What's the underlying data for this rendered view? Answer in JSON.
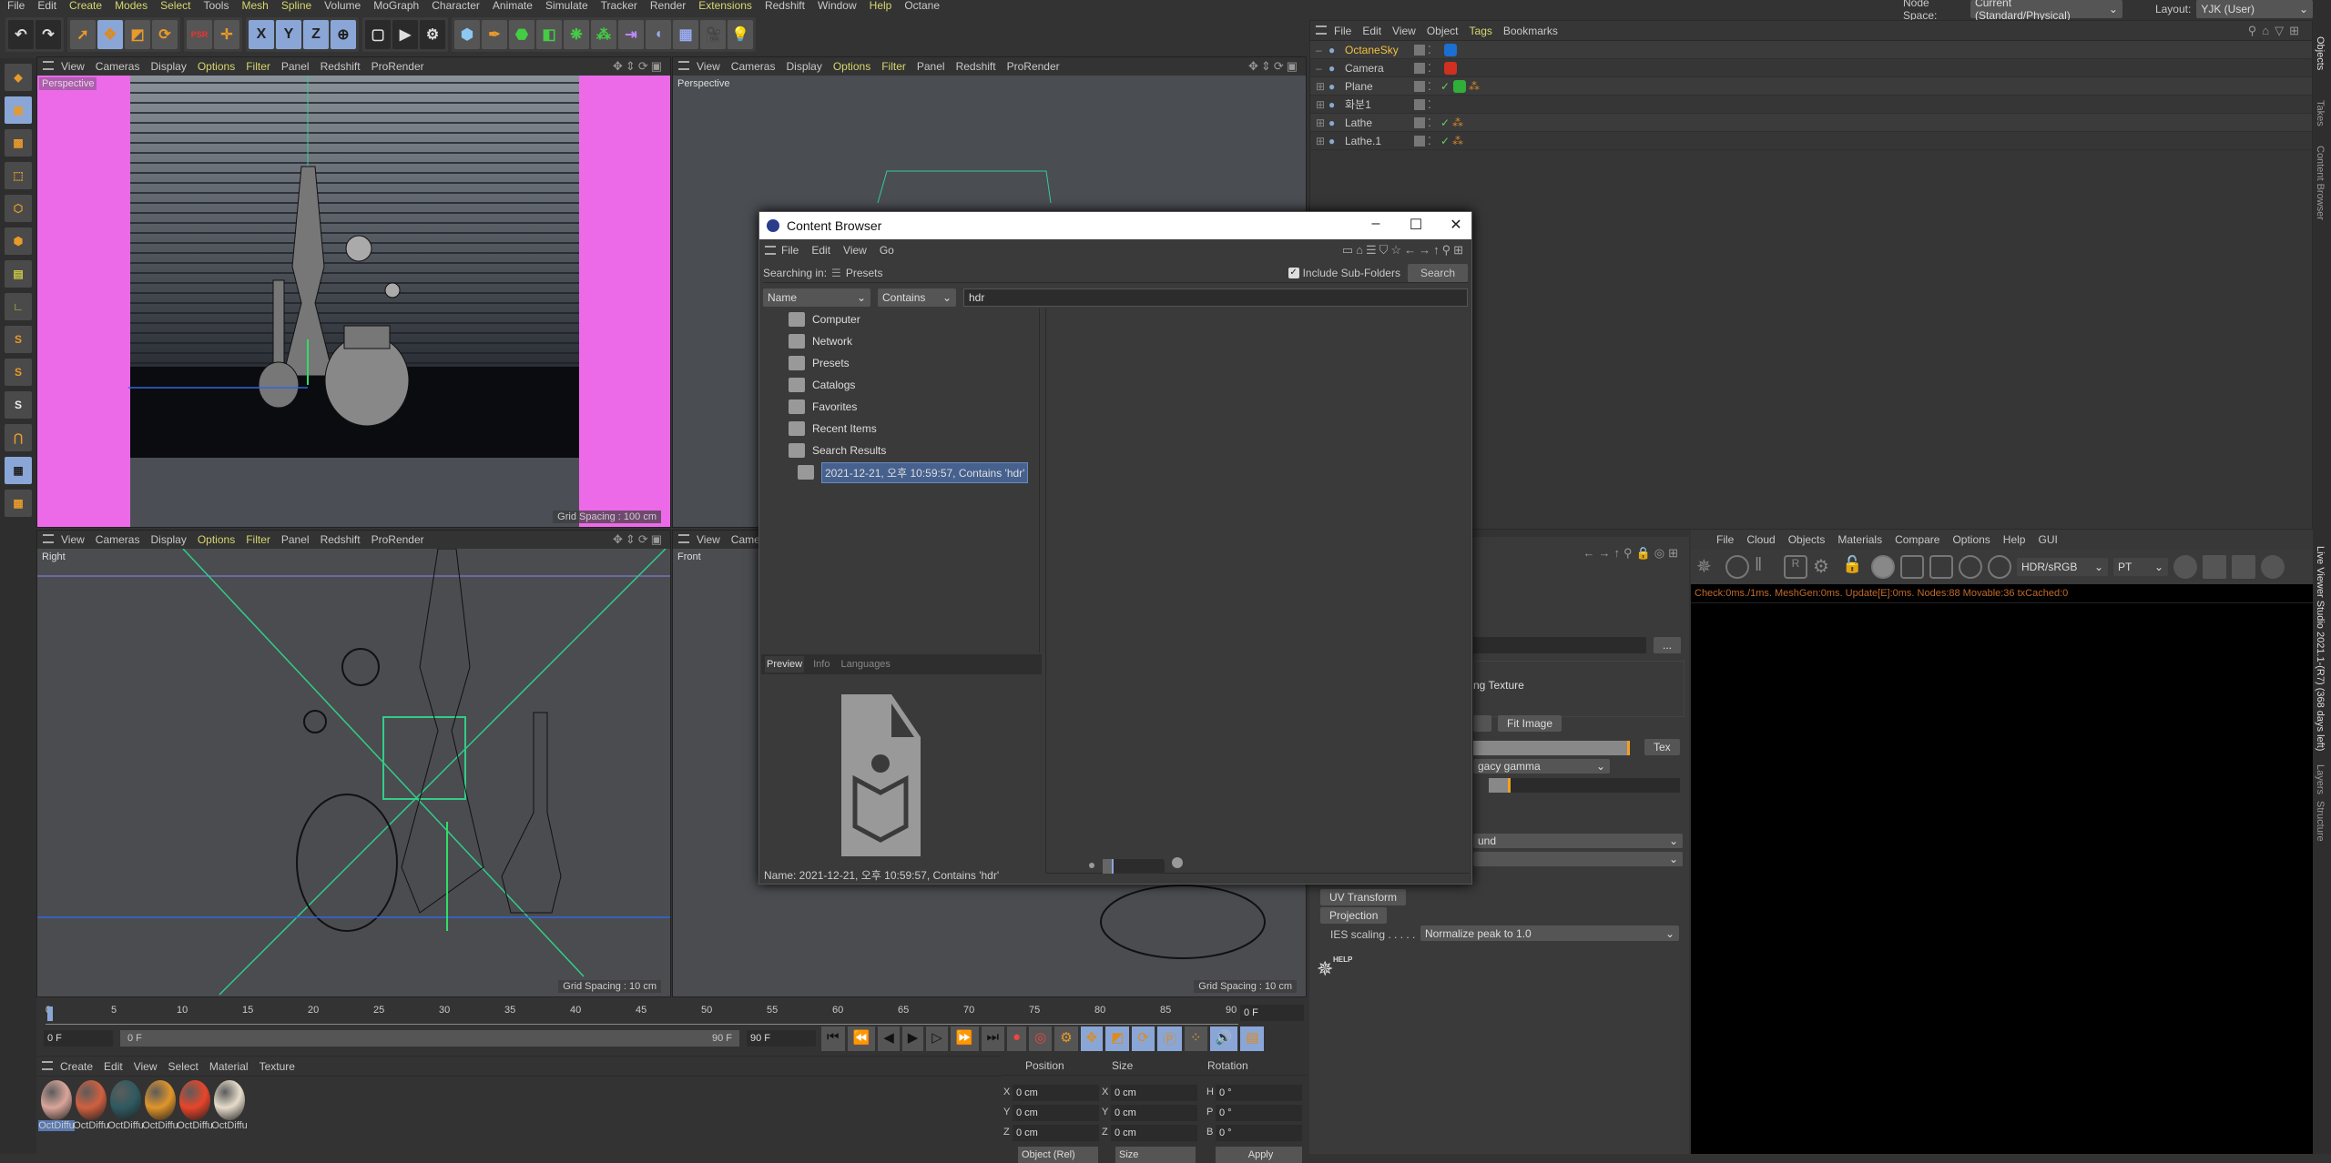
{
  "menubar": [
    {
      "label": "File",
      "hl": false
    },
    {
      "label": "Edit",
      "hl": false
    },
    {
      "label": "Create",
      "hl": true
    },
    {
      "label": "Modes",
      "hl": true
    },
    {
      "label": "Select",
      "hl": true
    },
    {
      "label": "Tools",
      "hl": false
    },
    {
      "label": "Mesh",
      "hl": true
    },
    {
      "label": "Spline",
      "hl": true
    },
    {
      "label": "Volume",
      "hl": false
    },
    {
      "label": "MoGraph",
      "hl": false
    },
    {
      "label": "Character",
      "hl": false
    },
    {
      "label": "Animate",
      "hl": false
    },
    {
      "label": "Simulate",
      "hl": false
    },
    {
      "label": "Tracker",
      "hl": false
    },
    {
      "label": "Render",
      "hl": false
    },
    {
      "label": "Extensions",
      "hl": true
    },
    {
      "label": "Redshift",
      "hl": false
    },
    {
      "label": "Window",
      "hl": false
    },
    {
      "label": "Help",
      "hl": true
    },
    {
      "label": "Octane",
      "hl": false
    }
  ],
  "toolbar": {
    "axis": [
      "X",
      "Y",
      "Z"
    ],
    "psr": "PSR"
  },
  "top_right": {
    "node_space_label": "Node Space:",
    "node_space_value": "Current (Standard/Physical)",
    "layout_label": "Layout:",
    "layout_value": "YJK (User)"
  },
  "viewport_menu": [
    "View",
    "Cameras",
    "Display",
    "Options",
    "Filter",
    "Panel",
    "Redshift",
    "ProRender"
  ],
  "viewports": [
    {
      "name": "Perspective",
      "grid": "Grid Spacing : 100 cm"
    },
    {
      "name": "Perspective",
      "grid": ""
    },
    {
      "name": "Right",
      "grid": "Grid Spacing : 10 cm"
    },
    {
      "name": "Front",
      "grid": "Grid Spacing : 10 cm"
    }
  ],
  "objects": {
    "menu": [
      "File",
      "Edit",
      "View",
      "Object",
      "Tags",
      "Bookmarks"
    ],
    "items": [
      {
        "name": "OctaneSky",
        "active": true,
        "tag": "#1a6fd1"
      },
      {
        "name": "Camera",
        "active": false,
        "tag": "#d03020"
      },
      {
        "name": "Plane",
        "active": false,
        "tag": "#2fae3a"
      },
      {
        "name": "화분1",
        "active": false,
        "tag": ""
      },
      {
        "name": "Lathe",
        "active": false,
        "tag": ""
      },
      {
        "name": "Lathe.1",
        "active": false,
        "tag": ""
      }
    ]
  },
  "content_browser": {
    "title": "Content Browser",
    "menu": [
      "File",
      "Edit",
      "View",
      "Go"
    ],
    "searching_in_label": "Searching in:",
    "searching_in_value": "Presets",
    "include_subfolders": "Include Sub-Folders",
    "include_subfolders_checked": true,
    "search_button": "Search",
    "field_select": "Name",
    "mode_select": "Contains",
    "query": "hdr",
    "tree": [
      "Computer",
      "Network",
      "Presets",
      "Catalogs",
      "Favorites",
      "Recent Items",
      "Search Results"
    ],
    "search_result": "2021-12-21, 오후 10:59:57, Contains 'hdr'",
    "tabs": [
      "Preview",
      "Info",
      "Languages"
    ],
    "name_line": "Name:  2021-12-21, 오후 10:59:57, Contains 'hdr'"
  },
  "timeline": {
    "ticks": [
      "0",
      "5",
      "10",
      "15",
      "20",
      "25",
      "30",
      "35",
      "40",
      "45",
      "50",
      "55",
      "60",
      "65",
      "70",
      "75",
      "80",
      "85",
      "90"
    ],
    "current": "0 F",
    "start": "0 F",
    "range_start": "0 F",
    "range_end": "90 F",
    "end": "90 F"
  },
  "materials": {
    "menu": [
      "Create",
      "Edit",
      "View",
      "Select",
      "Material",
      "Texture"
    ],
    "items": [
      {
        "label": "OctDiffu",
        "color": "#d9a59a"
      },
      {
        "label": "OctDiffu",
        "color": "#d0603f"
      },
      {
        "label": "OctDiffu",
        "color": "#2f5a60"
      },
      {
        "label": "OctDiffu",
        "color": "#e0952a"
      },
      {
        "label": "OctDiffu",
        "color": "#e8452a"
      },
      {
        "label": "OctDiffu",
        "color": "#e6dccb"
      }
    ]
  },
  "coordinates": {
    "headers": [
      "Position",
      "Size",
      "Rotation"
    ],
    "rows": [
      {
        "a": "X",
        "pos": "0 cm",
        "b": "X",
        "size": "0 cm",
        "c": "H",
        "rot": "0 °"
      },
      {
        "a": "Y",
        "pos": "0 cm",
        "b": "Y",
        "size": "0 cm",
        "c": "P",
        "rot": "0 °"
      },
      {
        "a": "Z",
        "pos": "0 cm",
        "b": "Z",
        "size": "0 cm",
        "c": "B",
        "rot": "0 °"
      }
    ],
    "mode": "Object (Rel)",
    "size_mode": "Size",
    "apply": "Apply"
  },
  "attributes": {
    "file_button": "...",
    "texture_text": "ng Texture",
    "fit_image": "Fit Image",
    "tex": "Tex",
    "gamma": "gacy gamma",
    "und": "und",
    "uv_transform": "UV Transform",
    "projection": "Projection",
    "ies_label": "IES scaling . . . . .",
    "ies_value": "Normalize peak to 1.0",
    "help": "HELP"
  },
  "live_viewer": {
    "menu": [
      "File",
      "Cloud",
      "Objects",
      "Materials",
      "Compare",
      "Options",
      "Help",
      "GUI"
    ],
    "color_space": "HDR/sRGB",
    "kernel": "PT",
    "status": "Check:0ms./1ms. MeshGen:0ms. Update[E]:0ms. Nodes:88 Movable:36 txCached:0"
  },
  "right_tabs": [
    "Objects",
    "Takes",
    "Content Browser",
    "Live Viewer Studio 2021.1-(R7) (368 days left)",
    "Layers",
    "Structure"
  ]
}
